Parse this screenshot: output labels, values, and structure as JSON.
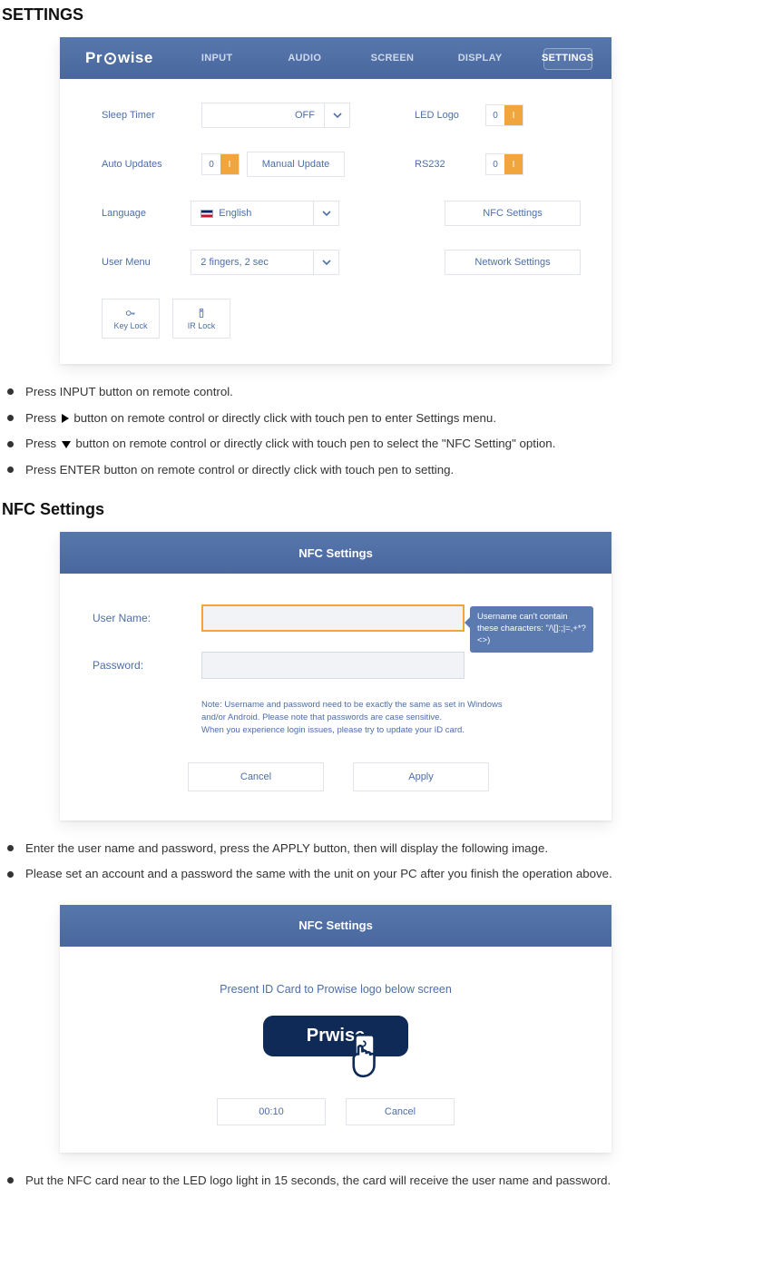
{
  "heading1": "SETTINGS",
  "logo_text_a": "Pr",
  "logo_text_b": "wise",
  "tabs": [
    "INPUT",
    "AUDIO",
    "SCREEN",
    "DISPLAY",
    "SETTINGS"
  ],
  "active_tab_index": 4,
  "settings": {
    "sleep_timer_label": "Sleep Timer",
    "sleep_timer_value": "OFF",
    "led_logo_label": "LED Logo",
    "auto_updates_label": "Auto Updates",
    "manual_update_btn": "Manual Update",
    "rs232_label": "RS232",
    "language_label": "Language",
    "language_value": "English",
    "nfc_settings_btn": "NFC Settings",
    "user_menu_label": "User Menu",
    "user_menu_value": "2 fingers, 2 sec",
    "network_settings_btn": "Network Settings",
    "toggle_off": "0",
    "toggle_on": "I",
    "key_lock": "Key Lock",
    "ir_lock": "IR Lock"
  },
  "bullets1": {
    "b1": "Press INPUT button on remote control.",
    "b2a": "Press ",
    "b2b": " button on remote control or directly click with touch pen to enter Settings menu.",
    "b3a": "Press ",
    "b3b": " button on remote control  or directly click with touch pen to select the \"NFC Setting\" option.",
    "b4": "Press ENTER button on remote control or directly click with touch pen to setting."
  },
  "heading2": "NFC Settings",
  "nfc": {
    "header": "NFC Settings",
    "username_label": "User Name:",
    "password_label": "Password:",
    "tooltip": "Username can't contain these characters: \"/\\[]:;|=,+*?<>)",
    "note": "Note: Username and password need to be exactly the same as set in Windows and/or Android. Please note that passwords are case sensitive.\nWhen you experience login issues, please try to update your ID card.",
    "cancel": "Cancel",
    "apply": "Apply"
  },
  "bullets2": {
    "b1": "Enter the user name and password, press the APPLY button, then will display the following image.",
    "b2": "Please set an account and a password the same with the unit on your PC after you finish the operation above."
  },
  "present": {
    "header": "NFC Settings",
    "text": "Present ID Card to Prowise logo below screen",
    "card_logo_a": "Pr",
    "card_logo_b": "wise",
    "timer": "00:10",
    "cancel": "Cancel"
  },
  "bullets3": {
    "b1": "Put the  NFC card near to the LED logo light in 15 seconds, the card will receive the user name and password."
  }
}
